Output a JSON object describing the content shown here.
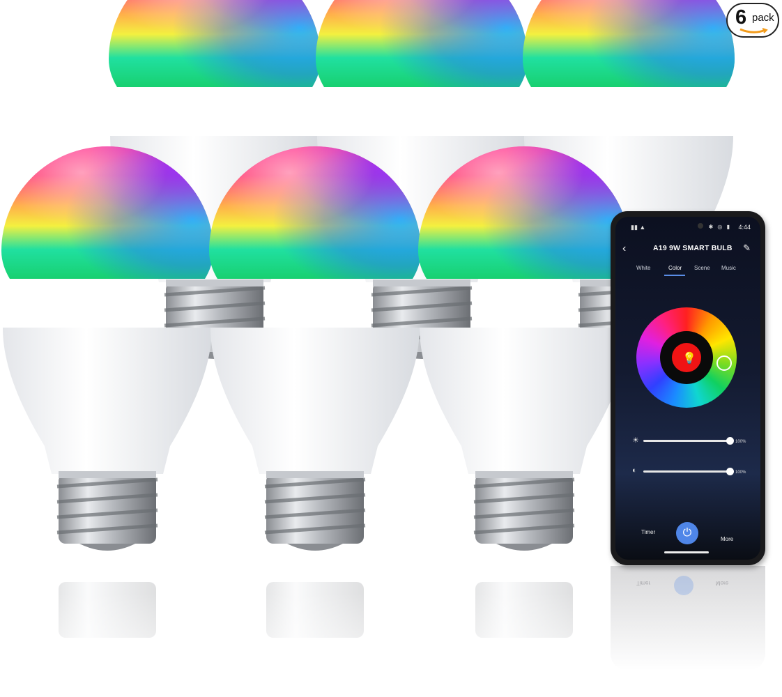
{
  "badge": {
    "count": "6",
    "word": "pack"
  },
  "product": {
    "bulb_count": 6
  },
  "phone": {
    "status_time": "4:44",
    "app_title": "A19 9W SMART BULB",
    "tabs": [
      {
        "label": "White",
        "active": false
      },
      {
        "label": "Color",
        "active": true
      },
      {
        "label": "Scene",
        "active": false
      },
      {
        "label": "Music",
        "active": false
      }
    ],
    "selected_color": "#f01414",
    "brightness": {
      "value": 1.0,
      "label": "100%"
    },
    "saturation": {
      "value": 1.0,
      "label": "100%"
    },
    "bottom": {
      "left_label": "Timer",
      "right_label": "More"
    }
  },
  "reflection": {
    "left_label": "Timer",
    "right_label": "More"
  }
}
